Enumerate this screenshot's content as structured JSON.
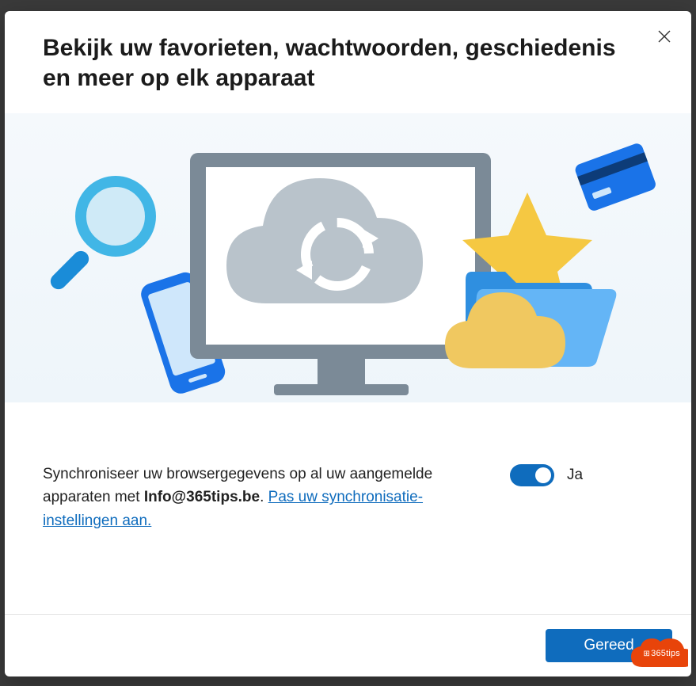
{
  "dialog": {
    "title": "Bekijk uw favorieten, wachtwoorden, geschiedenis en meer op elk apparaat",
    "body_text_pre": "Synchroniseer uw browsergegevens op al uw aangemelde apparaten met ",
    "account": "Info@365tips.be",
    "body_text_post": ". ",
    "link_text": "Pas uw synchronisatie-instellingen aan.",
    "toggle_label": "Ja",
    "toggle_on": true,
    "done_label": "Gereed"
  },
  "badge": {
    "text": "365tips"
  },
  "colors": {
    "accent": "#0f6cbd",
    "badge": "#e8440a"
  }
}
